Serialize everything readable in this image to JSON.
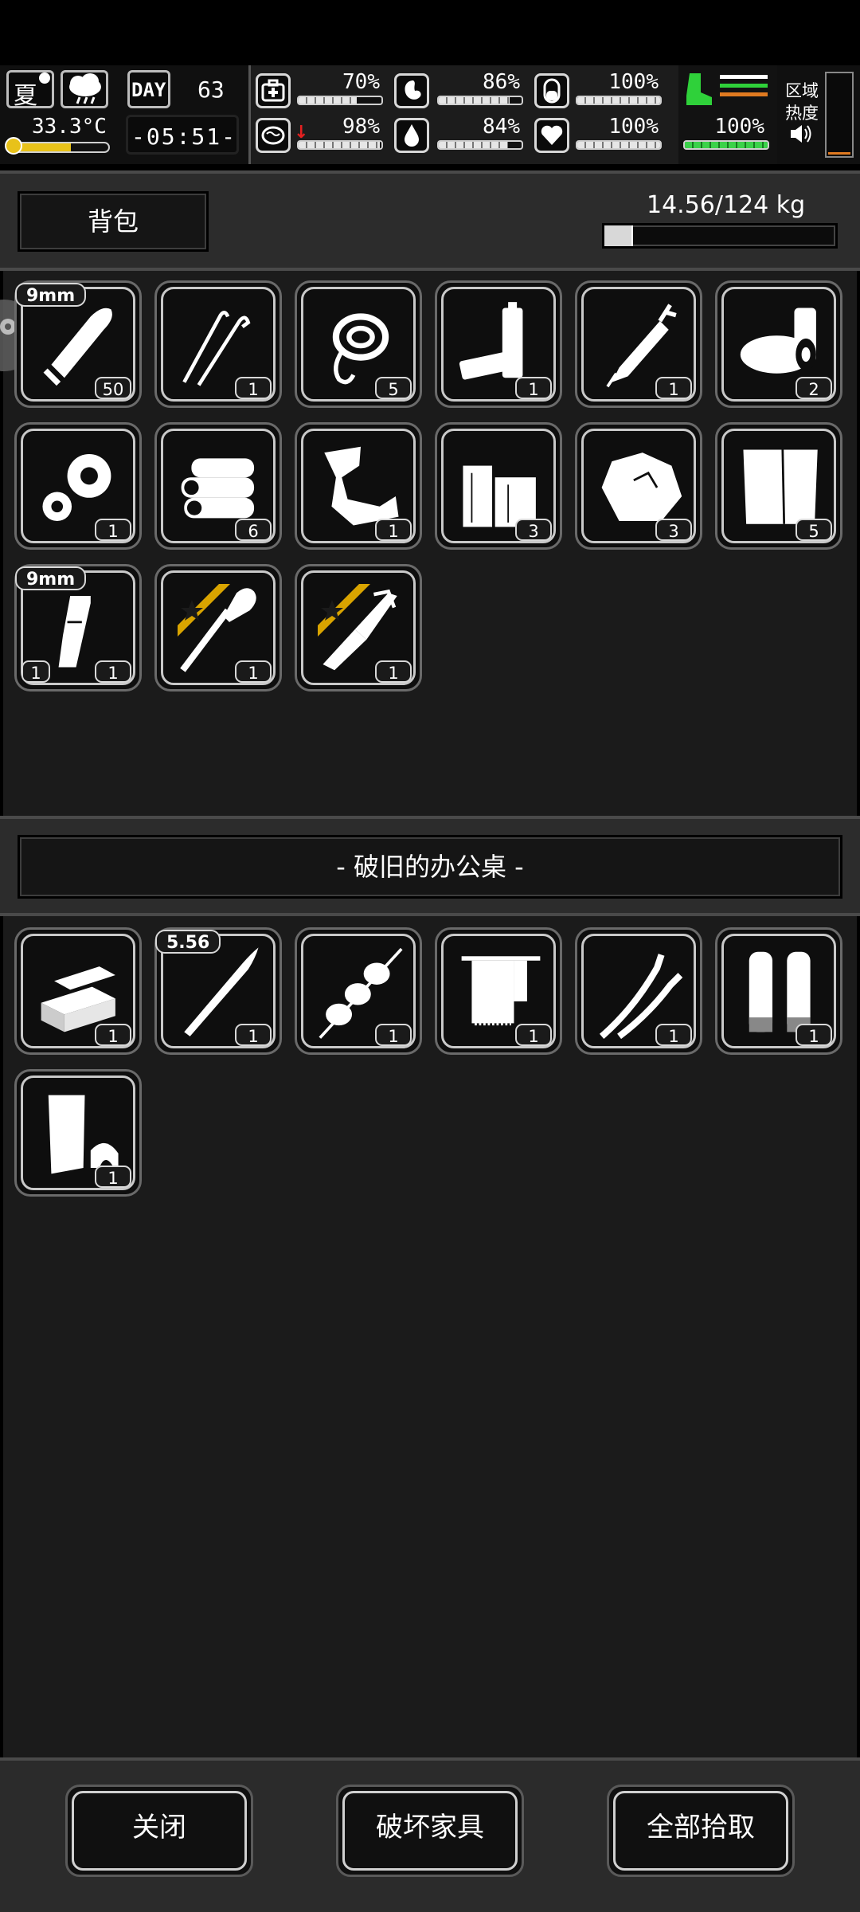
{
  "hud": {
    "season": "夏",
    "temperature": "33.3°C",
    "day_label": "DAY",
    "day_number": "63",
    "clock": "-05:51-",
    "stats": [
      {
        "icon": "medkit-icon",
        "value": "70%",
        "fill": 0.7
      },
      {
        "icon": "stomach-icon",
        "value": "86%",
        "fill": 0.86
      },
      {
        "icon": "sleep-capsule-icon",
        "value": "100%",
        "fill": 1.0
      },
      {
        "icon": "brain-icon",
        "value": "98%",
        "fill": 0.98
      },
      {
        "icon": "water-drop-icon",
        "value": "84%",
        "fill": 0.84
      },
      {
        "icon": "heart-icon",
        "value": "100%",
        "fill": 1.0
      }
    ],
    "stamina_value": "100%",
    "stamina_fill": 1.0,
    "zone_label_1": "区域",
    "zone_label_2": "热度"
  },
  "backpack": {
    "title": "背包",
    "weight": "14.56/124 kg",
    "weight_fraction": 0.117,
    "items": [
      {
        "icon": "bullet-icon",
        "count": "50",
        "badge": "9mm"
      },
      {
        "icon": "lockpick-icon",
        "count": "1"
      },
      {
        "icon": "rope-icon",
        "count": "5"
      },
      {
        "icon": "battery-icon",
        "count": "1"
      },
      {
        "icon": "syringe-icon",
        "count": "1"
      },
      {
        "icon": "tape-roll-icon",
        "count": "2"
      },
      {
        "icon": "gears-icon",
        "count": "1"
      },
      {
        "icon": "logs-icon",
        "count": "6"
      },
      {
        "icon": "scrap-icon",
        "count": "1"
      },
      {
        "icon": "planks-icon",
        "count": "3"
      },
      {
        "icon": "ore-icon",
        "count": "3"
      },
      {
        "icon": "cloth-icon",
        "count": "5"
      },
      {
        "icon": "magazine-icon",
        "count": "1",
        "count_left": "1",
        "badge": "9mm"
      },
      {
        "icon": "shovel-icon",
        "count": "1",
        "favorite": true
      },
      {
        "icon": "knife-icon",
        "count": "1",
        "favorite": true
      }
    ]
  },
  "container": {
    "title": "- 破旧的办公桌 -",
    "items": [
      {
        "icon": "metal-ingots-icon",
        "count": "1"
      },
      {
        "icon": "rifle-bullet-icon",
        "count": "1",
        "badge": "5.56"
      },
      {
        "icon": "food-skewer-icon",
        "count": "1"
      },
      {
        "icon": "towel-icon",
        "count": "1"
      },
      {
        "icon": "wires-icon",
        "count": "1"
      },
      {
        "icon": "tubes-icon",
        "count": "1"
      },
      {
        "icon": "paper-roll-icon",
        "count": "1"
      }
    ]
  },
  "buttons": {
    "close": "关闭",
    "destroy": "破坏家具",
    "take_all": "全部拾取"
  }
}
